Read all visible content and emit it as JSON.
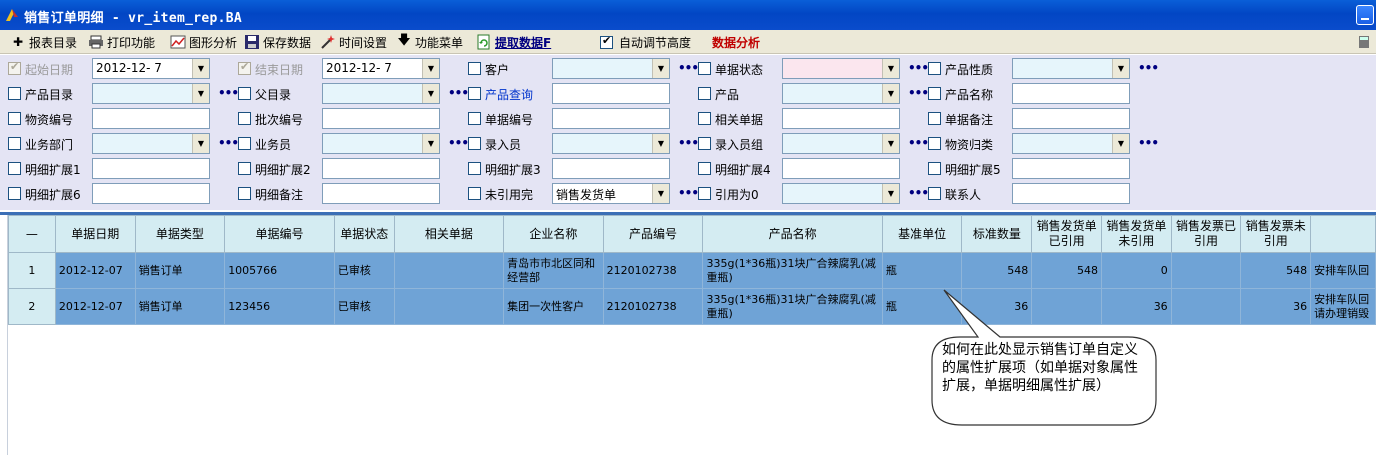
{
  "window": {
    "title": "销售订单明细 - vr_item_rep.BA"
  },
  "toolbar": {
    "items": [
      {
        "label": "报表目录",
        "icon": "plus-icon"
      },
      {
        "label": "打印功能",
        "icon": "printer-icon"
      },
      {
        "label": "图形分析",
        "icon": "chart-icon"
      },
      {
        "label": "保存数据",
        "icon": "save-icon"
      },
      {
        "label": "时间设置",
        "icon": "wand-icon"
      },
      {
        "label": "功能菜单",
        "icon": "down-arrow-icon"
      }
    ],
    "fetch_label": "提取数据F",
    "auto_height_label": "自动调节高度",
    "auto_height_checked": true,
    "analysis_label": "数据分析"
  },
  "filters": {
    "rows": [
      [
        {
          "label": "起始日期",
          "value": "2012-12-  7",
          "kind": "combo-white",
          "checked": true,
          "disabled": true
        },
        {
          "label": "结束日期",
          "value": "2012-12-  7",
          "kind": "combo-white",
          "checked": true,
          "disabled": true
        },
        {
          "label": "客户",
          "value": "",
          "kind": "combo",
          "ellipsis": true
        },
        {
          "label": "单据状态",
          "value": "",
          "kind": "combo-pink",
          "ellipsis": true
        },
        {
          "label": "产品性质",
          "value": "",
          "kind": "combo",
          "ellipsis": true
        }
      ],
      [
        {
          "label": "产品目录",
          "value": "",
          "kind": "combo",
          "ellipsis": true
        },
        {
          "label": "父目录",
          "value": "",
          "kind": "combo",
          "ellipsis": true
        },
        {
          "label": "产品查询",
          "value": "",
          "kind": "text",
          "link": true
        },
        {
          "label": "产品",
          "value": "",
          "kind": "combo",
          "ellipsis": true
        },
        {
          "label": "产品名称",
          "value": "",
          "kind": "text"
        }
      ],
      [
        {
          "label": "物资编号",
          "value": "",
          "kind": "text"
        },
        {
          "label": "批次编号",
          "value": "",
          "kind": "text"
        },
        {
          "label": "单据编号",
          "value": "",
          "kind": "text"
        },
        {
          "label": "相关单据",
          "value": "",
          "kind": "text"
        },
        {
          "label": "单据备注",
          "value": "",
          "kind": "text"
        }
      ],
      [
        {
          "label": "业务部门",
          "value": "",
          "kind": "combo",
          "ellipsis": true
        },
        {
          "label": "业务员",
          "value": "",
          "kind": "combo",
          "ellipsis": true
        },
        {
          "label": "录入员",
          "value": "",
          "kind": "combo",
          "ellipsis": true
        },
        {
          "label": "录入员组",
          "value": "",
          "kind": "combo",
          "ellipsis": true
        },
        {
          "label": "物资归类",
          "value": "",
          "kind": "combo",
          "ellipsis": true
        }
      ],
      [
        {
          "label": "明细扩展1",
          "value": "",
          "kind": "text"
        },
        {
          "label": "明细扩展2",
          "value": "",
          "kind": "text"
        },
        {
          "label": "明细扩展3",
          "value": "",
          "kind": "text"
        },
        {
          "label": "明细扩展4",
          "value": "",
          "kind": "text"
        },
        {
          "label": "明细扩展5",
          "value": "",
          "kind": "text"
        }
      ],
      [
        {
          "label": "明细扩展6",
          "value": "",
          "kind": "text"
        },
        {
          "label": "明细备注",
          "value": "",
          "kind": "text"
        },
        {
          "label": "未引用完",
          "value": "销售发货单",
          "kind": "combo-white",
          "ellipsis": true
        },
        {
          "label": "引用为0",
          "value": "",
          "kind": "combo",
          "ellipsis": true
        },
        {
          "label": "联系人",
          "value": "",
          "kind": "text"
        }
      ]
    ]
  },
  "grid": {
    "columns": [
      "—",
      "单据日期",
      "单据类型",
      "单据编号",
      "单据状态",
      "相关单据",
      "企业名称",
      "产品编号",
      "产品名称",
      "基准单位",
      "标准数量",
      "销售发货单已引用",
      "销售发货单未引用",
      "销售发票已引用",
      "销售发票未引用",
      ""
    ],
    "rows": [
      [
        "1",
        "2012-12-07",
        "销售订单",
        "1005766",
        "已审核",
        "",
        "青岛市市北区同和经营部",
        "2120102738",
        "335g(1*36瓶)31块广合辣腐乳(减重瓶)",
        "瓶",
        "548",
        "548",
        "0",
        "",
        "548",
        "安排车队回"
      ],
      [
        "2",
        "2012-12-07",
        "销售订单",
        "123456",
        "已审核",
        "",
        "集团一次性客户",
        "2120102738",
        "335g(1*36瓶)31块广合辣腐乳(减重瓶)",
        "瓶",
        "36",
        "",
        "36",
        "",
        "36",
        "安排车队回请办理销毁"
      ]
    ]
  },
  "callout": {
    "text": "如何在此处显示销售订单自定义的属性扩展项（如单据对象属性扩展，单据明细属性扩展）"
  }
}
